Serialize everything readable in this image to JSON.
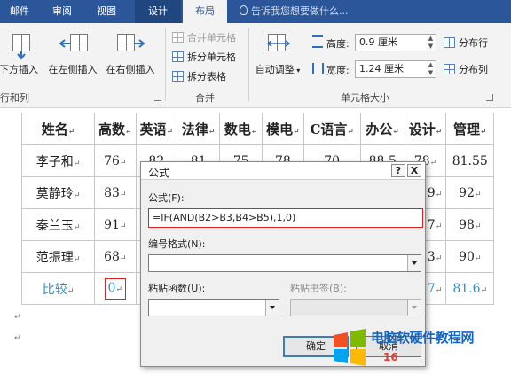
{
  "ribbon": {
    "tabs": [
      {
        "label": "邮件"
      },
      {
        "label": "审阅"
      },
      {
        "label": "视图"
      },
      {
        "label": "设计"
      },
      {
        "label": "布局"
      }
    ],
    "tell_me": "告诉我您想要做什么...",
    "rows_cols": {
      "insert_below": "下方插入",
      "insert_left": "在左侧插入",
      "insert_right": "在右侧插入",
      "group_label": "行和列"
    },
    "merge": {
      "merge_cells": "合并单元格",
      "split_cells": "拆分单元格",
      "split_table": "拆分表格",
      "group_label": "合并"
    },
    "cell_size": {
      "autofit": "自动调整",
      "height_label": "高度:",
      "height_value": "0.9 厘米",
      "width_label": "宽度:",
      "width_value": "1.24 厘米",
      "distribute_rows": "分布行",
      "distribute_cols": "分布列",
      "group_label": "单元格大小"
    }
  },
  "table": {
    "headers": [
      "姓名",
      "高数",
      "英语",
      "法律",
      "数电",
      "模电",
      "C语言",
      "办公",
      "设计",
      "管理"
    ],
    "rows": [
      [
        "李子和",
        "76",
        "82",
        "81",
        "75",
        "78",
        "70",
        "88.5",
        "78",
        "81.55"
      ],
      [
        "莫静玲",
        "83",
        "",
        "",
        "",
        "",
        "",
        "",
        "9",
        "92"
      ],
      [
        "秦兰玉",
        "91",
        "",
        "",
        "",
        "",
        "",
        "",
        "7",
        "98"
      ],
      [
        "范振理",
        "68",
        "",
        "",
        "",
        "",
        "",
        "",
        "3",
        "90"
      ],
      [
        "比较",
        "0",
        "",
        "",
        "",
        "",
        "",
        "",
        "7",
        "81.6"
      ]
    ]
  },
  "dialog": {
    "title": "公式",
    "help": "?",
    "close": "X",
    "formula_label": "公式(F):",
    "formula_value": "=IF(AND(B2>B3,B4>B5),1,0)",
    "number_format_label": "编号格式(N):",
    "number_format_value": "",
    "paste_function_label": "粘贴函数(U):",
    "paste_bookmark_label": "粘贴书签(B):",
    "ok": "确定",
    "cancel": "取消"
  },
  "watermark": {
    "line1": "电脑软硬件教程网",
    "line2": "16"
  },
  "colors": {
    "ribbon_blue": "#2b579a",
    "highlight_red": "#e02020",
    "compare_row_blue": "#2e8fd0"
  }
}
